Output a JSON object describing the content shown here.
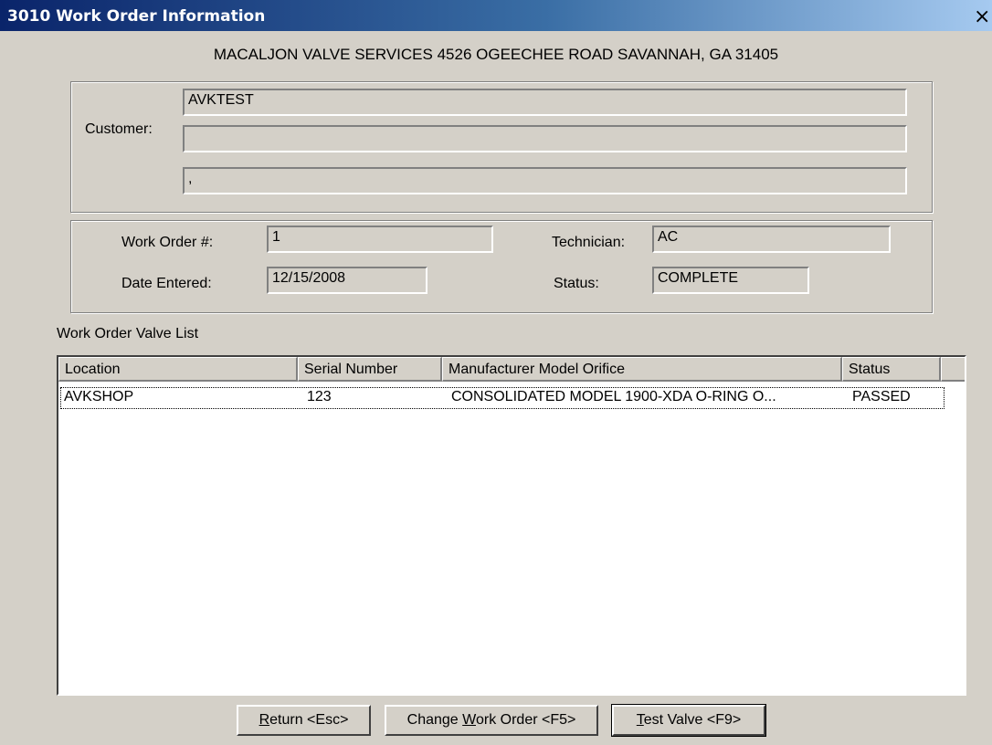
{
  "window": {
    "title": "3010 Work Order Information",
    "close_glyph": "×",
    "close_icon": "close-icon"
  },
  "header": {
    "company_line": "MACALJON VALVE SERVICES 4526 OGEECHEE ROAD SAVANNAH, GA 31405"
  },
  "customer": {
    "label": "Customer:",
    "line1": "AVKTEST",
    "line2": "",
    "line3": ","
  },
  "work_order": {
    "number_label": "Work Order #:",
    "number_value": "1",
    "date_label": "Date Entered:",
    "date_value": "12/15/2008",
    "technician_label": "Technician:",
    "technician_value": "AC",
    "status_label": "Status:",
    "status_value": "COMPLETE"
  },
  "valve_list": {
    "title": "Work Order Valve List",
    "columns": [
      "Location",
      "Serial Number",
      "Manufacturer Model Orifice",
      "Status"
    ],
    "rows": [
      [
        "AVKSHOP",
        "123",
        "CONSOLIDATED MODEL 1900-XDA O-RING O...",
        "PASSED"
      ]
    ]
  },
  "buttons": {
    "return": {
      "mnemonic": "R",
      "rest": "eturn <Esc>"
    },
    "change": {
      "pre": "Change ",
      "mnemonic": "W",
      "rest": "ork Order <F5>"
    },
    "test": {
      "mnemonic": "T",
      "rest": "est Valve <F9>"
    }
  }
}
